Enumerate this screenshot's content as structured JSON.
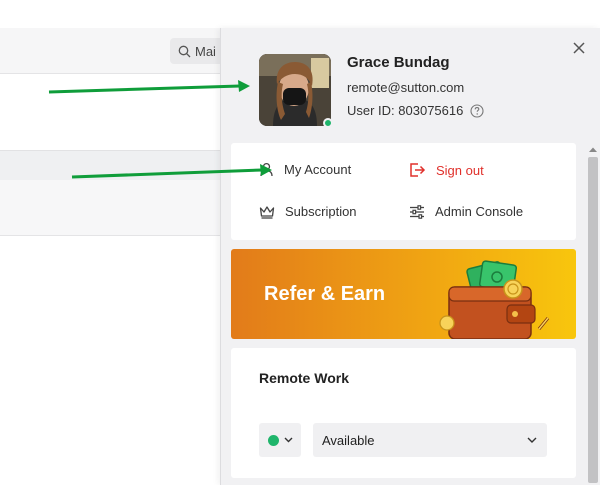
{
  "background": {
    "search_text": "Mai"
  },
  "profile": {
    "name": "Grace Bundag",
    "email": "remote@sutton.com",
    "user_id": "User ID: 803075616",
    "status_color": "#1fb56b"
  },
  "menu": {
    "my_account": "My Account",
    "sign_out": "Sign out",
    "subscription": "Subscription",
    "admin_console": "Admin Console",
    "sign_out_color": "#e0302b"
  },
  "banner": {
    "label": "Refer & Earn"
  },
  "remote_work": {
    "title": "Remote Work",
    "availability": "Available"
  },
  "icons": {
    "close": "close-icon",
    "help": "question-circle-icon",
    "account": "user-icon",
    "sign_out": "sign-out-icon",
    "subscription": "crown-icon",
    "admin": "sliders-icon",
    "search": "search-icon",
    "dropdown": "chevron-down-icon"
  },
  "colors": {
    "accent_green": "#1fb56b",
    "arrow_green": "#0f9d3a",
    "banner_orange": "#e27b1a",
    "banner_yellow": "#f8c60d"
  }
}
